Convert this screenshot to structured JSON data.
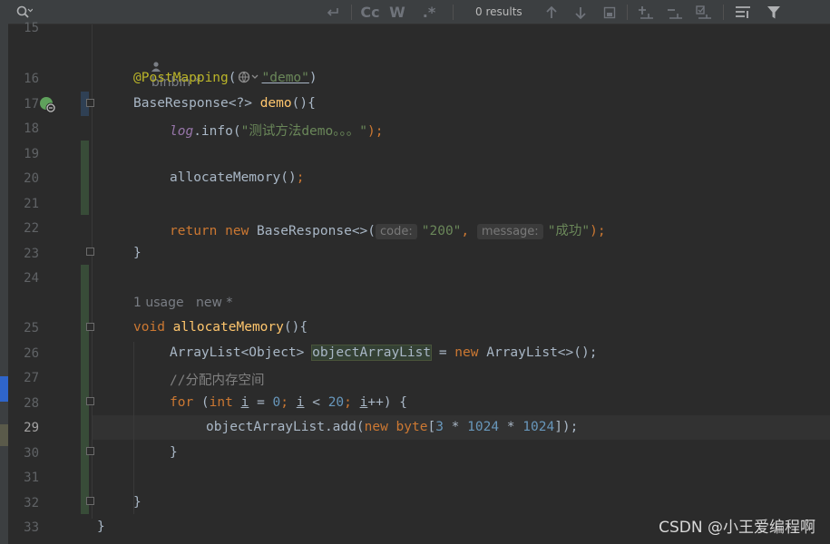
{
  "toolbar": {
    "search_icon": "search-icon",
    "results": "0 results",
    "match_case_label": "Cc",
    "words_label": "W",
    "regex_label": ".*"
  },
  "gutter": {
    "line_numbers": [
      "15",
      "16",
      "17",
      "18",
      "19",
      "20",
      "21",
      "22",
      "23",
      "24",
      "25",
      "26",
      "27",
      "28",
      "29",
      "30",
      "31",
      "32",
      "33"
    ],
    "current_line": "29"
  },
  "inlays": {
    "author_hint": "binbin *",
    "usage_hint": "1 usage   new *"
  },
  "code": {
    "l16_annotation": "@PostMapping",
    "l16_open": "(",
    "l16_string": "\"demo\"",
    "l16_close": ")",
    "l17_type": "BaseResponse<?> ",
    "l17_method": "demo",
    "l17_rest": "(){",
    "l18_field": "log",
    "l18_call": ".info(",
    "l18_string": "\"测试方法demo。。。\"",
    "l18_end": ");",
    "l20_call": "allocateMemory()",
    "l20_end": ";",
    "l22_return": "return",
    "l22_new": "new",
    "l22_type": " BaseResponse<>(",
    "l22_hint_code": "code:",
    "l22_str_code": "\"200\"",
    "l22_comma": ", ",
    "l22_hint_msg": "message:",
    "l22_str_msg": "\"成功\"",
    "l22_end": ");",
    "l23": "}",
    "l25_void": "void",
    "l25_method": "allocateMemory",
    "l25_rest": "(){",
    "l26_type": "ArrayList<Object> ",
    "l26_var": "objectArrayList",
    "l26_eq": " = ",
    "l26_new": "new",
    "l26_rest": " ArrayList<>();",
    "l27_comment": "//分配内存空间",
    "l28_for": "for",
    "l28_a": " (",
    "l28_int": "int",
    "l28_i1": "i",
    "l28_eq": " = ",
    "l28_zero": "0",
    "l28_semi1": "; ",
    "l28_i2": "i",
    "l28_lt": " < ",
    "l28_twenty": "20",
    "l28_semi2": "; ",
    "l28_i3": "i",
    "l28_end": "++) {",
    "l29_call": "objectArrayList.add(",
    "l29_new": "new",
    "l29_byte": "byte",
    "l29_br": "[",
    "l29_n1": "3",
    "l29_op1": " * ",
    "l29_n2": "1024",
    "l29_op2": " * ",
    "l29_n3": "1024",
    "l29_end": "]);",
    "l30": "}",
    "l32": "}",
    "l33": "}"
  },
  "watermark": "CSDN @小王爱编程啊",
  "colors": {
    "keyword": "#cc7832",
    "annotation": "#bbb529",
    "method": "#ffc66d",
    "string": "#6a8759",
    "number": "#6897bb",
    "field": "#9876aa",
    "comment": "#808080",
    "text": "#a9b7c6"
  }
}
